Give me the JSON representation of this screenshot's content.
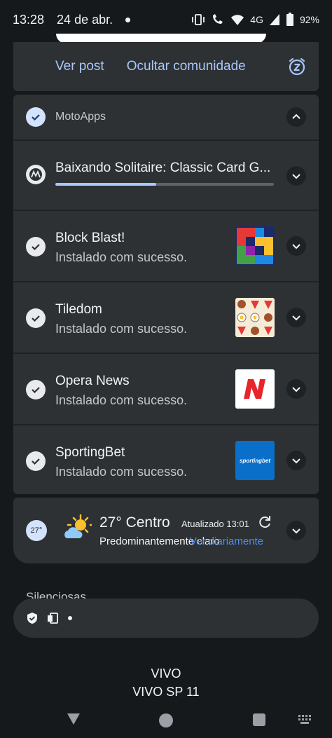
{
  "status_bar": {
    "time": "13:28",
    "date": "24 de abr.",
    "network": "4G",
    "battery": "92%"
  },
  "actions_card": {
    "view_post": "Ver post",
    "hide_community": "Ocultar comunidade"
  },
  "group": {
    "app_name": "MotoApps",
    "download": {
      "title": "Baixando Solitaire: Classic Card G...",
      "progress": 0.46
    },
    "notifications": [
      {
        "title": "Block Blast!",
        "text": "Instalado com sucesso.",
        "icon": "block-blast-icon"
      },
      {
        "title": "Tiledom",
        "text": "Instalado com sucesso.",
        "icon": "tiledom-icon"
      },
      {
        "title": "Opera News",
        "text": "Instalado com sucesso.",
        "icon": "opera-news-icon"
      },
      {
        "title": "SportingBet",
        "text": "Instalado com sucesso.",
        "icon": "sportingbet-icon",
        "thumb_label": "sportingbet"
      }
    ]
  },
  "weather": {
    "badge": "27°",
    "title": "27° Centro",
    "updated": "Atualizado 13:01",
    "description": "Predominantemente claro",
    "link": "Ver diariamente"
  },
  "silenced": {
    "label": "Silenciosas"
  },
  "carrier": {
    "line1": "VIVO",
    "line2": "VIVO SP 11"
  },
  "colors": {
    "card_bg": "#2d3134",
    "accent": "#a8c7fa",
    "link_blue": "#4c8df6",
    "sportingbet_blue": "#0a6fc9",
    "opera_red": "#e8242b"
  }
}
